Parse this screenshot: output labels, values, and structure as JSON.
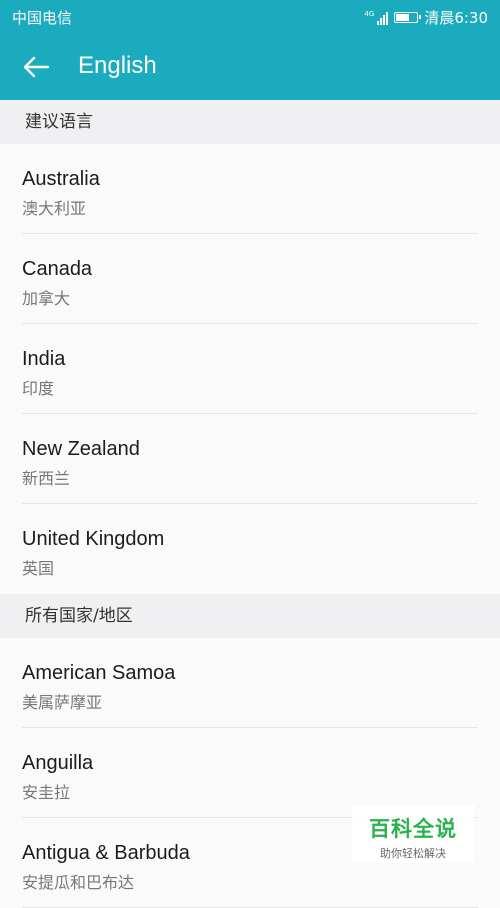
{
  "status_bar": {
    "carrier": "中国电信",
    "network": "4G",
    "time": "清晨6:30",
    "battery_level": 0.65
  },
  "app_bar": {
    "back_icon": "arrow-left-icon",
    "title": "English"
  },
  "sections": [
    {
      "header": "建议语言",
      "items": [
        {
          "en": "Australia",
          "zh": "澳大利亚"
        },
        {
          "en": "Canada",
          "zh": "加拿大"
        },
        {
          "en": "India",
          "zh": "印度"
        },
        {
          "en": "New Zealand",
          "zh": "新西兰"
        },
        {
          "en": "United Kingdom",
          "zh": "英国"
        }
      ]
    },
    {
      "header": "所有国家/地区",
      "items": [
        {
          "en": "American Samoa",
          "zh": "美属萨摩亚"
        },
        {
          "en": "Anguilla",
          "zh": "安圭拉"
        },
        {
          "en": "Antigua & Barbuda",
          "zh": "安提瓜和巴布达"
        }
      ]
    }
  ],
  "watermark": {
    "title": "百科全说",
    "subtitle": "助你轻松解决"
  },
  "colors": {
    "accent": "#1aacbe",
    "watermark_green": "#2bb24c"
  }
}
